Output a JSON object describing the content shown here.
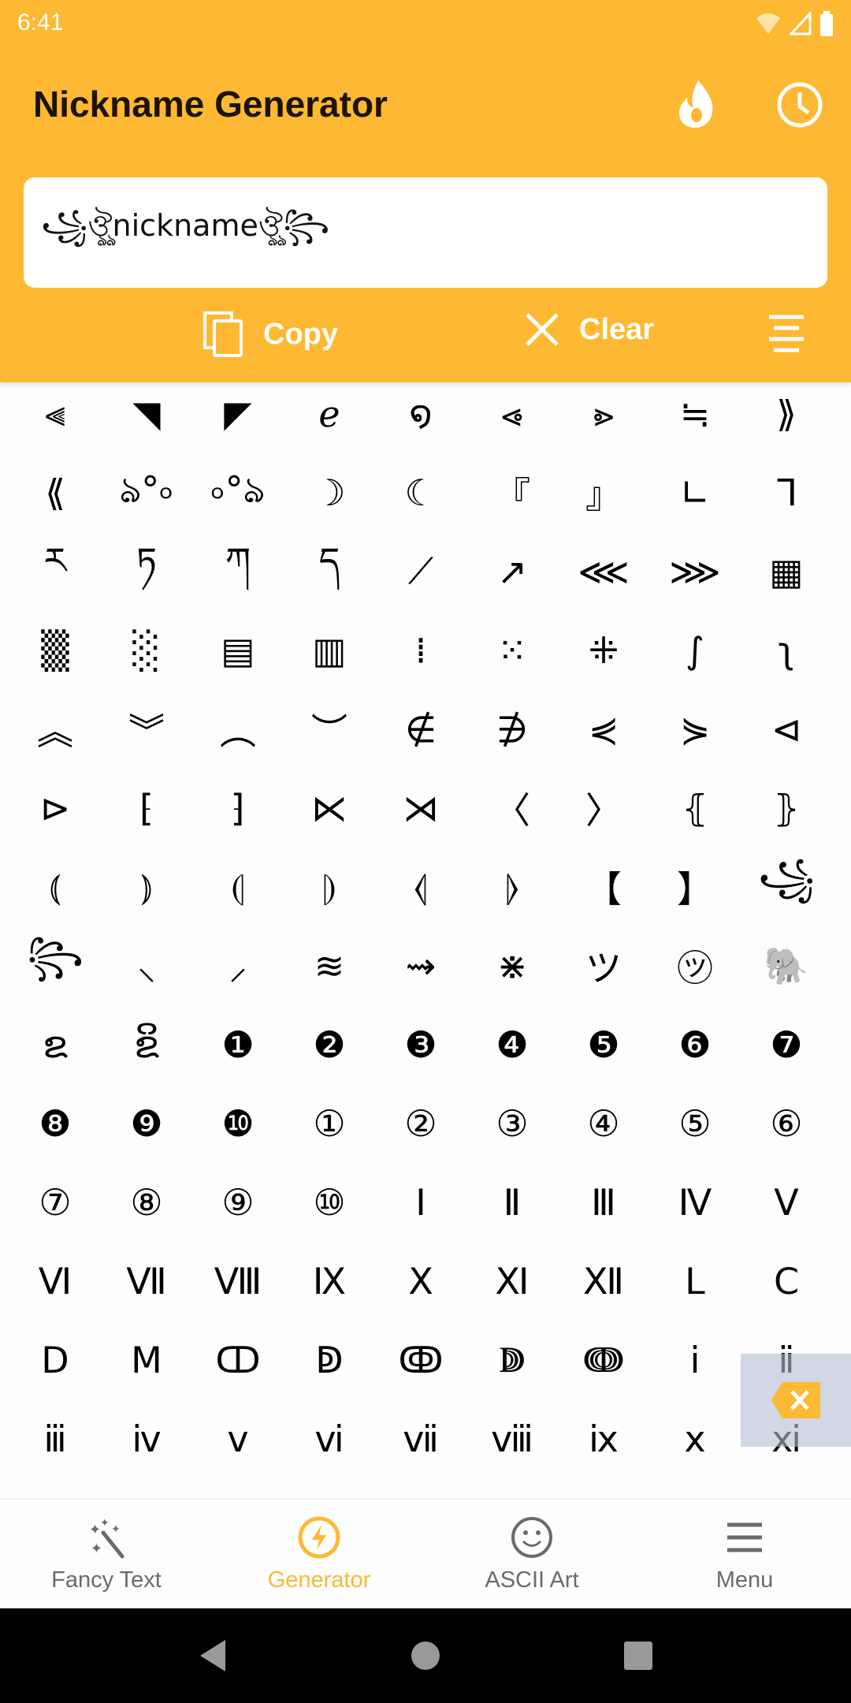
{
  "status_bar": {
    "time": "6:41"
  },
  "header": {
    "title": "Nickname Generator"
  },
  "input": {
    "value": "꧁ঔৣnicknameঔৣ꧂"
  },
  "actions": {
    "copy_label": "Copy",
    "clear_label": "Clear"
  },
  "symbols": [
    [
      "⫷",
      "◥",
      "◤",
      "ℯ",
      "໑",
      "⩹",
      "⩺",
      "≒",
      "⟫"
    ],
    [
      "⟪",
      "ঌ°৹",
      "৹°ঌ",
      "☽",
      "☾",
      "『",
      "』",
      "∟",
      "ᒣ"
    ],
    [
      "ཪ",
      "ཏ",
      "ཀ",
      "ད",
      "⟋",
      "↗",
      "⋘",
      "⋙",
      "▦"
    ],
    [
      "▒",
      "░",
      "▤",
      "▥",
      "⁞",
      "⁙",
      "⁜",
      "∫",
      "ʅ"
    ],
    [
      "︽",
      "︾",
      "︵",
      "︶",
      "∉",
      "∌",
      "⋞",
      "⋟",
      "⊲"
    ],
    [
      "⊳",
      "⁅",
      "⁆",
      "⋉",
      "⋊",
      "〈",
      "〉",
      "⦃",
      "⦄"
    ],
    [
      "⦅",
      "⦆",
      "⦇",
      "⦈",
      "⦉",
      "⦊",
      "【",
      "】",
      "꧁"
    ],
    [
      "꧂",
      "⸜",
      "⸝",
      "≋",
      "⇝",
      "⋇",
      "ツ",
      "㋡",
      "🐘"
    ],
    [
      "ຂ",
      "ຂິ",
      "❶",
      "❷",
      "❸",
      "❹",
      "❺",
      "❻",
      "❼"
    ],
    [
      "❽",
      "❾",
      "❿",
      "①",
      "②",
      "③",
      "④",
      "⑤",
      "⑥"
    ],
    [
      "⑦",
      "⑧",
      "⑨",
      "⑩",
      "Ⅰ",
      "Ⅱ",
      "Ⅲ",
      "Ⅳ",
      "Ⅴ"
    ],
    [
      "Ⅵ",
      "Ⅶ",
      "Ⅷ",
      "Ⅸ",
      "Ⅹ",
      "Ⅺ",
      "Ⅻ",
      "Ⅼ",
      "Ⅽ"
    ],
    [
      "Ⅾ",
      "Ⅿ",
      "ↀ",
      "ↁ",
      "ↂ",
      "ↇ",
      "ↈ",
      "ⅰ",
      "ⅱ"
    ],
    [
      "ⅲ",
      "ⅳ",
      "ⅴ",
      "ⅵ",
      "ⅶ",
      "ⅷ",
      "ⅸ",
      "ⅹ",
      "ⅺ"
    ]
  ],
  "bottom_nav": [
    {
      "label": "Fancy Text",
      "icon": "magic-wand-icon"
    },
    {
      "label": "Generator",
      "icon": "lightning-icon",
      "active": true
    },
    {
      "label": "ASCII Art",
      "icon": "smiley-icon"
    },
    {
      "label": "Menu",
      "icon": "hamburger-icon"
    }
  ],
  "colors": {
    "accent": "#fdb933",
    "nav_inactive": "#6b6b6b"
  }
}
